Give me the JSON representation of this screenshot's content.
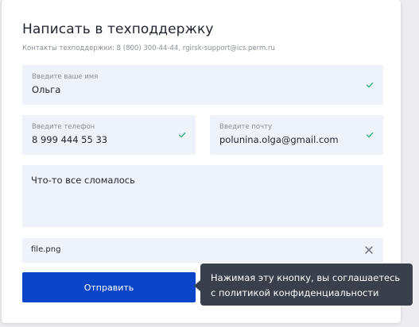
{
  "form": {
    "title": "Написать в техподдержку",
    "contacts": "Контакты техподдержки: 8 (800) 300-44-44, rgirsk-support@ics.perm.ru"
  },
  "fields": {
    "name": {
      "label": "Введите ваше имя",
      "value": "Ольга",
      "status_icon": "check-icon"
    },
    "phone": {
      "label": "Введите телефон",
      "value": "8 999 444 55 33",
      "status_icon": "check-icon"
    },
    "email": {
      "label": "Введите почту",
      "value": "polunina.olga@gmail.com",
      "status_icon": "check-icon"
    },
    "message": {
      "value": "Что-то все сломалось"
    }
  },
  "attachment": {
    "filename": "file.png",
    "remove_icon": "close-icon"
  },
  "submit": {
    "label": "Отправить"
  },
  "tooltip": {
    "line1": "Нажимая эту кнопку, вы соглашаетесь",
    "line2": "с политикой конфиденциальности"
  },
  "colors": {
    "primary": "#0b46c8",
    "field_bg": "#eef3fa",
    "check": "#36b37e",
    "tooltip_bg": "#3a3f4c"
  }
}
